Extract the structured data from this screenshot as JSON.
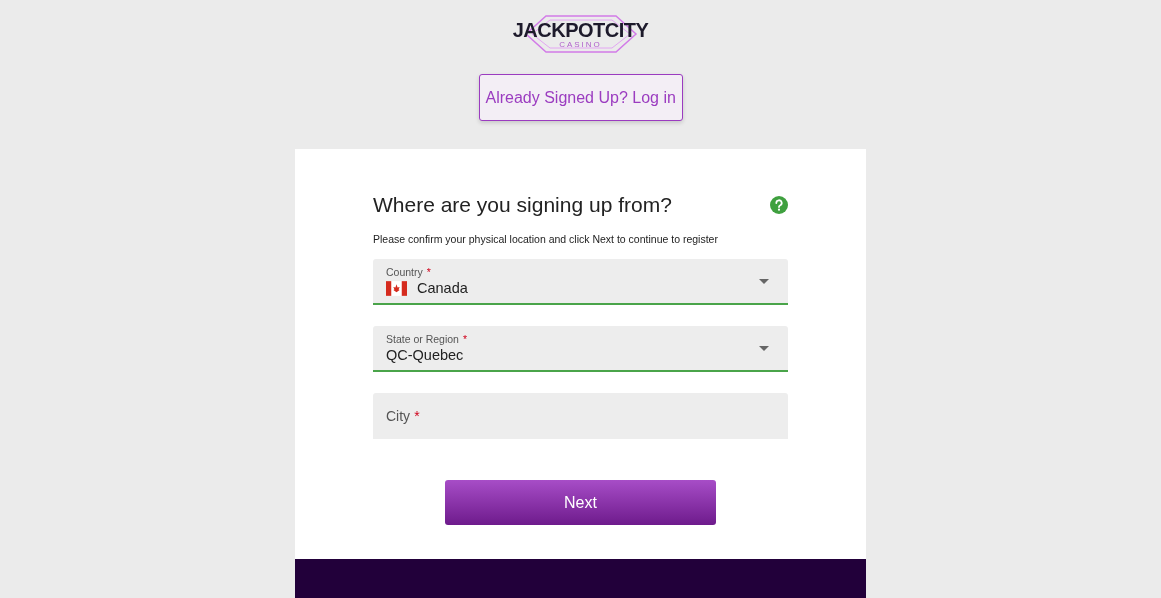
{
  "logo": {
    "name": "JACKPOTCITY",
    "tagline": "CASINO"
  },
  "login_button": "Already Signed Up? Log in",
  "form": {
    "title": "Where are you signing up from?",
    "subtitle": "Please confirm your physical location and click Next to continue to register",
    "fields": [
      {
        "kind": "country",
        "label": "Country",
        "required_mark": "*",
        "value": "Canada",
        "valid": true
      },
      {
        "kind": "select",
        "label": "State or Region",
        "required_mark": "*",
        "value": "QC-Quebec",
        "valid": true
      },
      {
        "kind": "text",
        "label": "City",
        "required_mark": "*",
        "valid": false
      }
    ],
    "next_button": "Next"
  }
}
